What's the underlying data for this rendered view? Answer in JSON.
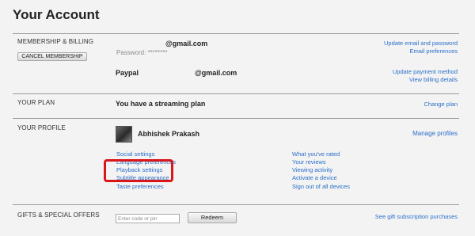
{
  "page": {
    "title": "Your Account"
  },
  "membership": {
    "section_label": "MEMBERSHIP & BILLING",
    "cancel_label": "CANCEL MEMBERSHIP",
    "email": "@gmail.com",
    "password": "Password: ********",
    "update_email": "Update email and password",
    "email_prefs": "Email preferences",
    "payment_method": "Paypal",
    "payment_email": "@gmail.com",
    "update_payment": "Update payment method",
    "billing_details": "View billing details"
  },
  "plan": {
    "section_label": "YOUR PLAN",
    "plan_text": "You have a streaming plan",
    "change_plan": "Change plan"
  },
  "profile": {
    "section_label": "YOUR PROFILE",
    "user_name": "Abhishek Prakash",
    "manage_profiles": "Manage profiles",
    "left_links": [
      "Social settings",
      "Language preferences",
      "Playback settings",
      "Subtitle appearance",
      "Taste preferences"
    ],
    "right_links": [
      "What you've rated",
      "Your reviews",
      "Viewing activity",
      "Activate a device",
      "Sign out of all devices"
    ]
  },
  "gifts": {
    "section_label": "GIFTS & SPECIAL OFFERS",
    "code_placeholder": "Enter code or pin",
    "redeem_label": "Redeem",
    "gift_link": "See gift subscription purchases"
  },
  "colors": {
    "link": "#2a6fc9",
    "highlight": "#d9161b",
    "background": "#f3f3f3"
  }
}
